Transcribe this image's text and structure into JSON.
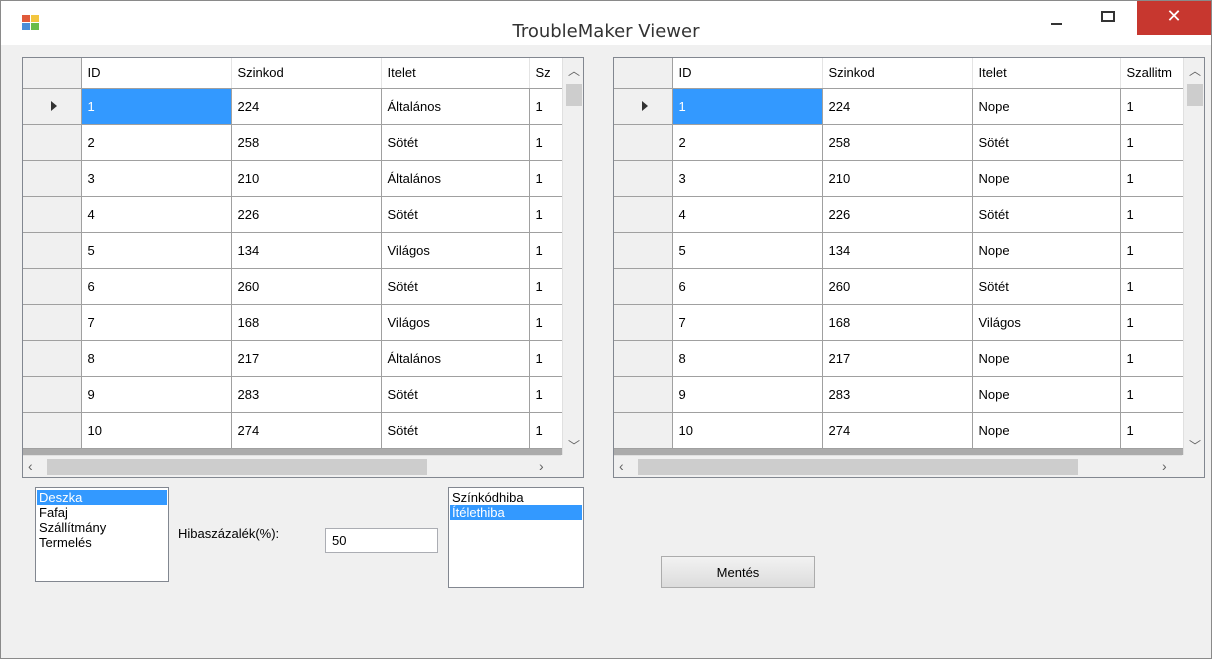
{
  "window": {
    "title": "TroubleMaker Viewer",
    "close_glyph": "✕"
  },
  "left_grid": {
    "columns": [
      "ID",
      "Szinkod",
      "Itelet",
      "Sz"
    ],
    "rows": [
      [
        "1",
        "224",
        "Általános",
        "1"
      ],
      [
        "2",
        "258",
        "Sötét",
        "1"
      ],
      [
        "3",
        "210",
        "Általános",
        "1"
      ],
      [
        "4",
        "226",
        "Sötét",
        "1"
      ],
      [
        "5",
        "134",
        "Világos",
        "1"
      ],
      [
        "6",
        "260",
        "Sötét",
        "1"
      ],
      [
        "7",
        "168",
        "Világos",
        "1"
      ],
      [
        "8",
        "217",
        "Általános",
        "1"
      ],
      [
        "9",
        "283",
        "Sötét",
        "1"
      ],
      [
        "10",
        "274",
        "Sötét",
        "1"
      ]
    ]
  },
  "right_grid": {
    "columns": [
      "ID",
      "Szinkod",
      "Itelet",
      "Szallitm"
    ],
    "rows": [
      [
        "1",
        "224",
        "Nope",
        "1"
      ],
      [
        "2",
        "258",
        "Sötét",
        "1"
      ],
      [
        "3",
        "210",
        "Nope",
        "1"
      ],
      [
        "4",
        "226",
        "Sötét",
        "1"
      ],
      [
        "5",
        "134",
        "Nope",
        "1"
      ],
      [
        "6",
        "260",
        "Sötét",
        "1"
      ],
      [
        "7",
        "168",
        "Világos",
        "1"
      ],
      [
        "8",
        "217",
        "Nope",
        "1"
      ],
      [
        "9",
        "283",
        "Nope",
        "1"
      ],
      [
        "10",
        "274",
        "Nope",
        "1"
      ]
    ]
  },
  "category_list": {
    "items": [
      "Deszka",
      "Fafaj",
      "Szállítmány",
      "Termelés"
    ],
    "selected": "Deszka"
  },
  "error_percent": {
    "label": "Hibaszázalék(%):",
    "value": "50"
  },
  "error_type_list": {
    "items": [
      "Színkódhiba",
      "Ítélethiba"
    ],
    "selected": "Ítélethiba"
  },
  "save_button": {
    "label": "Mentés"
  },
  "colors": {
    "selection": "#3399ff",
    "close_button": "#c7372f",
    "grid_background": "#ababab",
    "window_background": "#f0f0f0"
  },
  "icons": {
    "app": "app-icon",
    "row_pointer": "row-pointer-icon",
    "scroll_up": "chevron-up-icon",
    "scroll_down": "chevron-down-icon",
    "scroll_left": "chevron-left-icon",
    "scroll_right": "chevron-right-icon"
  }
}
